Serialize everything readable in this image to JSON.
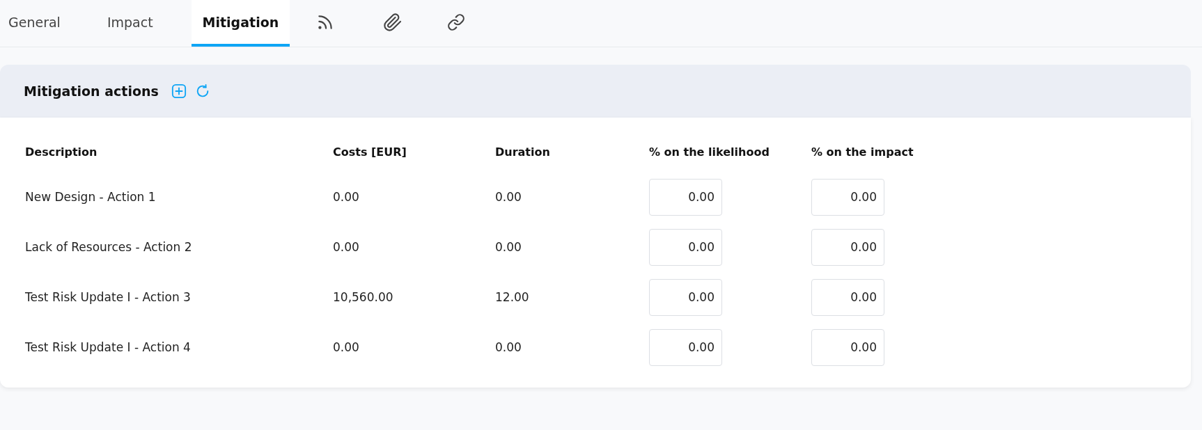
{
  "tabs": [
    {
      "label": "General",
      "selected": false
    },
    {
      "label": "Impact",
      "selected": false
    },
    {
      "label": "Mitigation",
      "selected": true
    }
  ],
  "icon_tabs": [
    {
      "selected": false
    },
    {
      "selected": false
    },
    {
      "selected": false
    }
  ],
  "panel": {
    "title": "Mitigation actions"
  },
  "table": {
    "columns": [
      "Description",
      "Costs [EUR]",
      "Duration",
      "% on the likelihood",
      "% on the impact"
    ],
    "rows": [
      {
        "description": "New Design - Action 1",
        "costs": "0.00",
        "duration": "0.00",
        "likelihood": "0.00",
        "impact": "0.00"
      },
      {
        "description": "Lack of Resources - Action 2",
        "costs": "0.00",
        "duration": "0.00",
        "likelihood": "0.00",
        "impact": "0.00"
      },
      {
        "description": "Test Risk Update I - Action 3",
        "costs": "10,560.00",
        "duration": "12.00",
        "likelihood": "0.00",
        "impact": "0.00"
      },
      {
        "description": "Test Risk Update I - Action 4",
        "costs": "0.00",
        "duration": "0.00",
        "likelihood": "0.00",
        "impact": "0.00"
      }
    ]
  }
}
